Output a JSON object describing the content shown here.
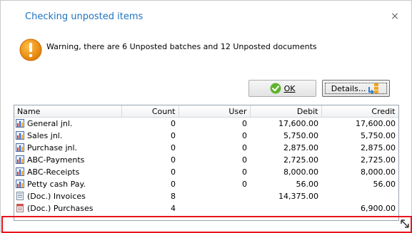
{
  "dialog": {
    "title": "Checking unposted items",
    "close_glyph": "×",
    "warning_icon": "warning-icon",
    "message": "Warning, there are 6 Unposted batches and 12 Unposted documents"
  },
  "buttons": {
    "ok_label": "OK",
    "details_label": "Details..."
  },
  "table": {
    "columns": [
      "Name",
      "Count",
      "User",
      "Debit",
      "Credit"
    ],
    "rows": [
      {
        "icon": "batch-icon",
        "name": "General jnl.",
        "count": "0",
        "user": "0",
        "debit": "17,600.00",
        "credit": "17,600.00"
      },
      {
        "icon": "batch-icon",
        "name": "Sales jnl.",
        "count": "0",
        "user": "0",
        "debit": "5,750.00",
        "credit": "5,750.00"
      },
      {
        "icon": "batch-icon",
        "name": "Purchase jnl.",
        "count": "0",
        "user": "0",
        "debit": "2,875.00",
        "credit": "2,875.00"
      },
      {
        "icon": "batch-icon",
        "name": "ABC-Payments",
        "count": "0",
        "user": "0",
        "debit": "2,725.00",
        "credit": "2,725.00"
      },
      {
        "icon": "batch-icon",
        "name": "ABC-Receipts",
        "count": "0",
        "user": "0",
        "debit": "8,000.00",
        "credit": "8,000.00"
      },
      {
        "icon": "batch-icon",
        "name": "Petty cash Pay.",
        "count": "0",
        "user": "0",
        "debit": "56.00",
        "credit": "56.00"
      },
      {
        "icon": "invoice-doc-icon",
        "name": "(Doc.) Invoices",
        "count": "8",
        "user": "",
        "debit": "14,375.00",
        "credit": ""
      },
      {
        "icon": "purchase-doc-icon",
        "name": "(Doc.) Purchases",
        "count": "4",
        "user": "",
        "debit": "",
        "credit": "6,900.00"
      }
    ]
  },
  "colors": {
    "title": "#1e73be",
    "warning": "#f08c0c",
    "highlight_frame": "#e8141c"
  }
}
